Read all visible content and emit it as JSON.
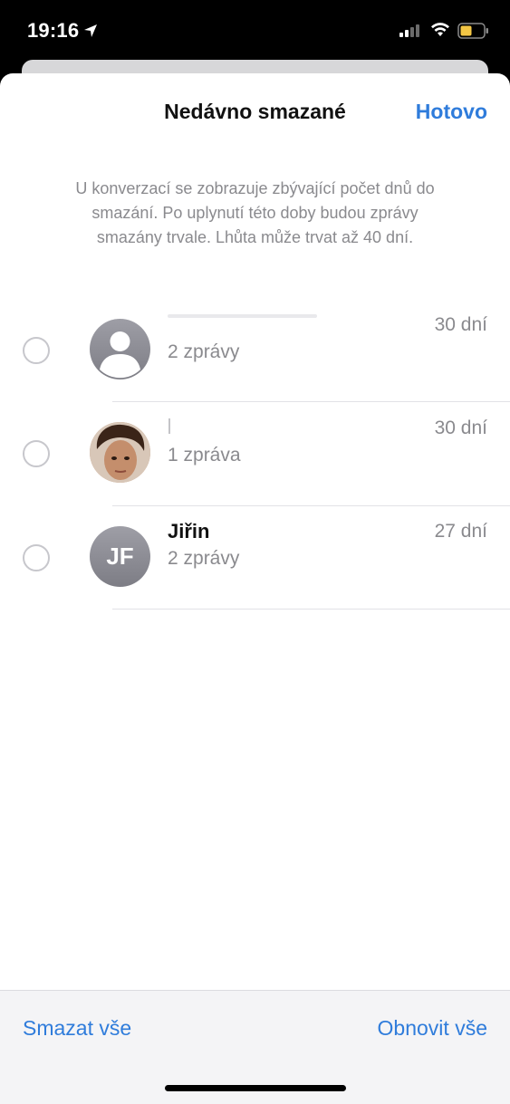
{
  "status_bar": {
    "time": "19:16"
  },
  "sheet": {
    "title": "Nedávno smazané",
    "done_label": "Hotovo",
    "info_text": "U konverzací se zobrazuje zbývající počet dnů do smazání. Po uplynutí této doby budou zprávy smazány trvale. Lhůta může trvat až 40 dní."
  },
  "conversations": [
    {
      "name": "",
      "count": "2 zprávy",
      "days": "30 dní",
      "avatar": "person-placeholder-icon"
    },
    {
      "name": "",
      "count": "1 zpráva",
      "days": "30 dní",
      "avatar": "contact-photo"
    },
    {
      "name": "Jiřin",
      "count": "2 zprávy",
      "days": "27 dní",
      "avatar": "initials",
      "initials": "JF"
    }
  ],
  "toolbar": {
    "delete_all_label": "Smazat vše",
    "restore_all_label": "Obnovit vše"
  }
}
